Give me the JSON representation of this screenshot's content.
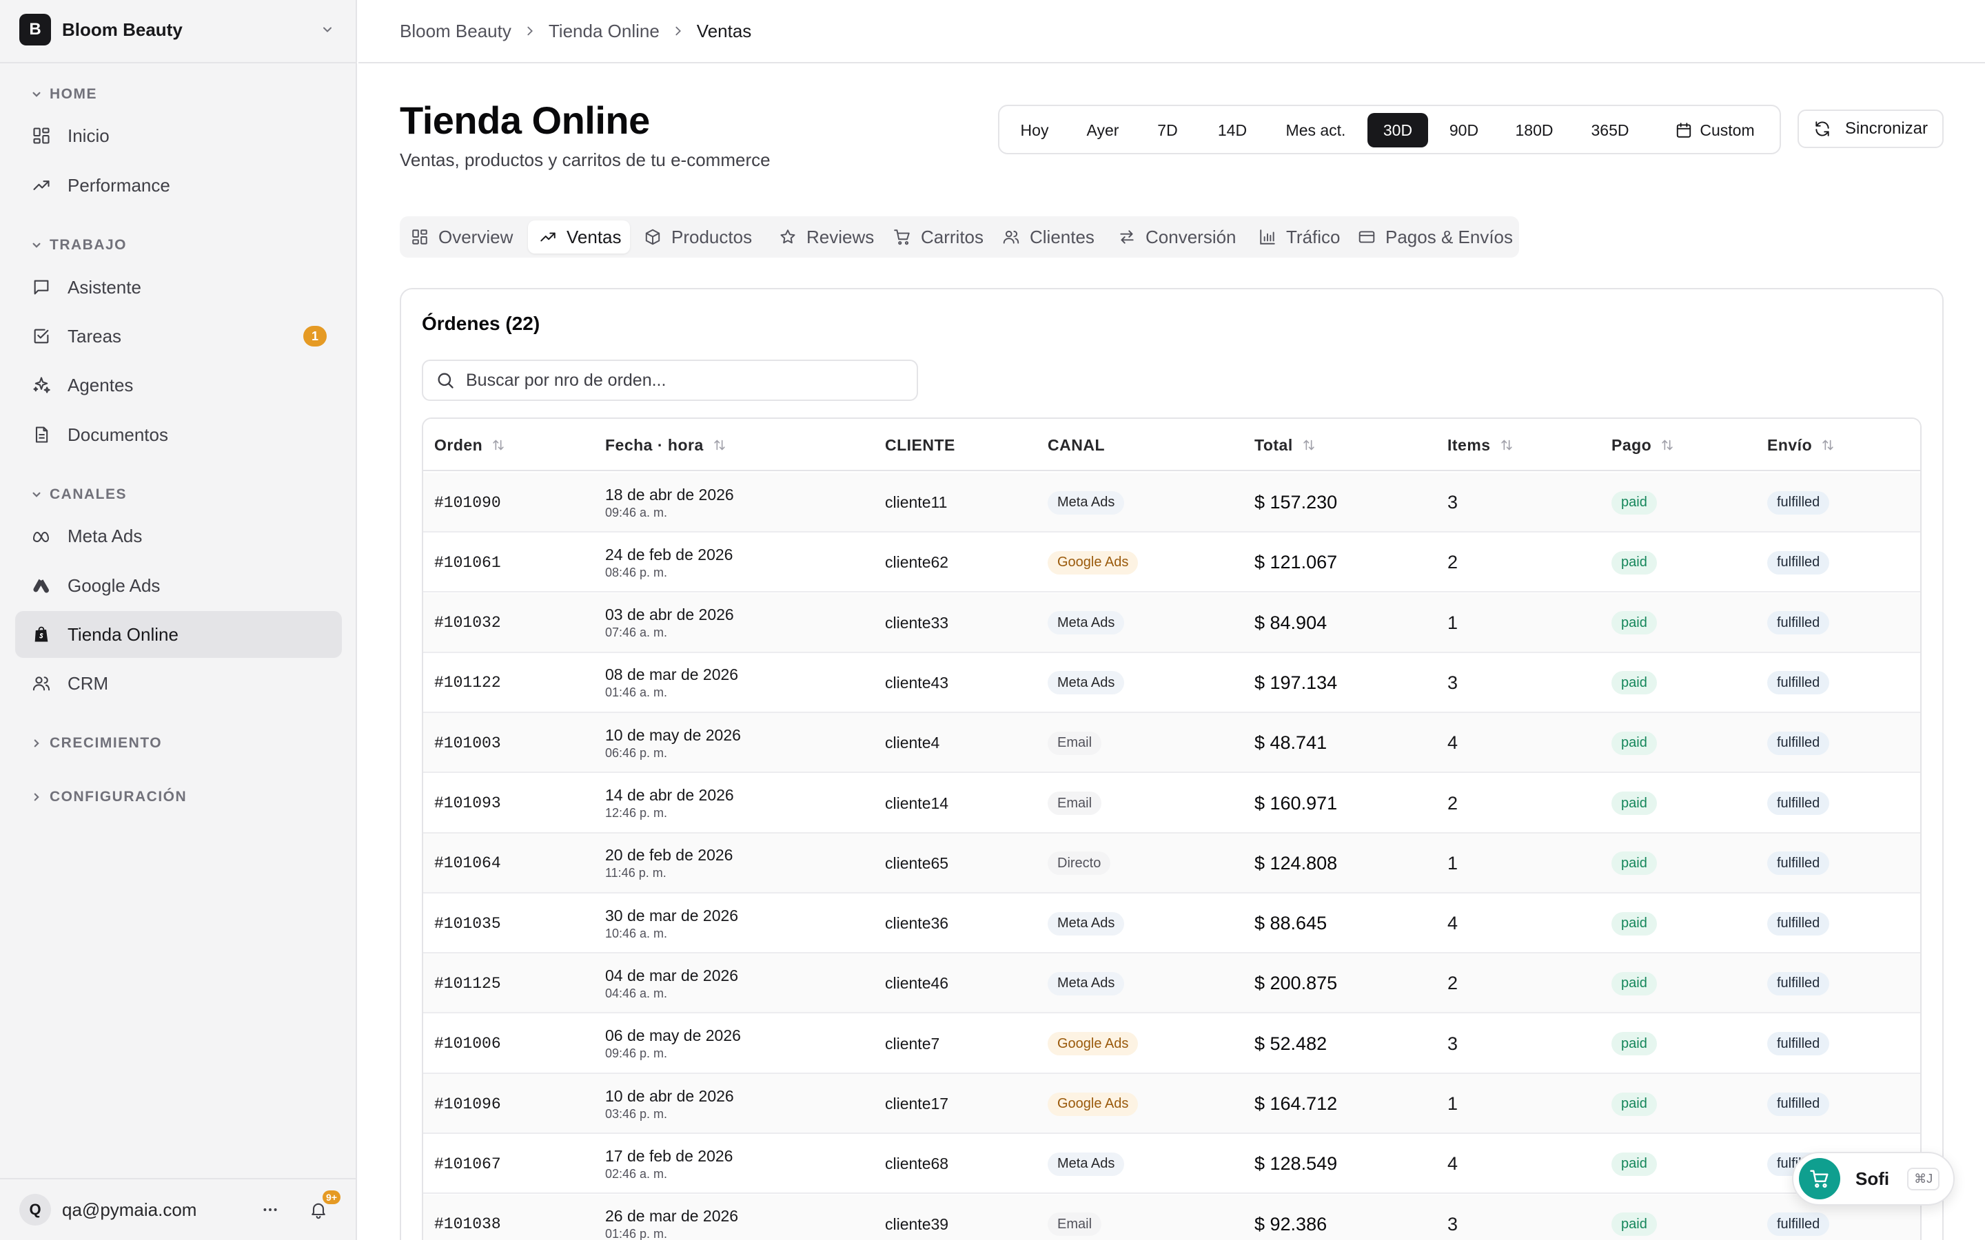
{
  "workspace": {
    "initial": "B",
    "name": "Bloom Beauty"
  },
  "sidebar": {
    "sections": [
      {
        "title": "HOME",
        "items": [
          {
            "label": "Inicio",
            "icon": "grid-icon"
          },
          {
            "label": "Performance",
            "icon": "trending-up-icon"
          }
        ]
      },
      {
        "title": "TRABAJO",
        "items": [
          {
            "label": "Asistente",
            "icon": "chat-icon"
          },
          {
            "label": "Tareas",
            "icon": "checkbox-icon",
            "badge": "1"
          },
          {
            "label": "Agentes",
            "icon": "sparkles-icon"
          },
          {
            "label": "Documentos",
            "icon": "document-icon"
          }
        ]
      },
      {
        "title": "CANALES",
        "items": [
          {
            "label": "Meta Ads",
            "icon": "meta-icon"
          },
          {
            "label": "Google Ads",
            "icon": "google-ads-icon"
          },
          {
            "label": "Tienda Online",
            "icon": "shopify-icon",
            "active": true
          },
          {
            "label": "CRM",
            "icon": "users-icon"
          }
        ]
      },
      {
        "title": "CRECIMIENTO",
        "items": []
      },
      {
        "title": "CONFIGURACIÓN",
        "items": []
      }
    ]
  },
  "user": {
    "initial": "Q",
    "email": "qa@pymaia.com",
    "notifications": "9+"
  },
  "breadcrumb": [
    "Bloom Beauty",
    "Tienda Online",
    "Ventas"
  ],
  "header": {
    "title": "Tienda Online",
    "subtitle": "Ventas, productos y carritos de tu e-commerce"
  },
  "ranges": [
    "Hoy",
    "Ayer",
    "7D",
    "14D",
    "Mes act.",
    "30D",
    "90D",
    "180D",
    "365D",
    "Custom"
  ],
  "active_range": "30D",
  "sync_label": "Sincronizar",
  "tabs": [
    {
      "label": "Overview",
      "icon": "grid-icon"
    },
    {
      "label": "Ventas",
      "icon": "trending-up-icon",
      "active": true
    },
    {
      "label": "Productos",
      "icon": "box-icon"
    },
    {
      "label": "Reviews",
      "icon": "star-icon"
    },
    {
      "label": "Carritos",
      "icon": "cart-icon"
    },
    {
      "label": "Clientes",
      "icon": "users-icon"
    },
    {
      "label": "Conversión",
      "icon": "arrows-icon"
    },
    {
      "label": "Tráfico",
      "icon": "bar-chart-icon"
    },
    {
      "label": "Pagos & Envíos",
      "icon": "credit-card-icon"
    }
  ],
  "orders": {
    "title": "Órdenes (22)",
    "search_placeholder": "Buscar por nro de orden...",
    "columns": [
      "Orden",
      "Fecha · hora",
      "CLIENTE",
      "CANAL",
      "Total",
      "Items",
      "Pago",
      "Envío"
    ],
    "rows": [
      {
        "orden": "#101090",
        "fecha": "18 de abr de 2026",
        "hora": "09:46 a. m.",
        "cliente": "cliente11",
        "canal": "Meta Ads",
        "total": "$ 157.230",
        "items": "3",
        "pago": "paid",
        "envio": "fulfilled"
      },
      {
        "orden": "#101061",
        "fecha": "24 de feb de 2026",
        "hora": "08:46 p. m.",
        "cliente": "cliente62",
        "canal": "Google Ads",
        "total": "$ 121.067",
        "items": "2",
        "pago": "paid",
        "envio": "fulfilled"
      },
      {
        "orden": "#101032",
        "fecha": "03 de abr de 2026",
        "hora": "07:46 a. m.",
        "cliente": "cliente33",
        "canal": "Meta Ads",
        "total": "$ 84.904",
        "items": "1",
        "pago": "paid",
        "envio": "fulfilled"
      },
      {
        "orden": "#101122",
        "fecha": "08 de mar de 2026",
        "hora": "01:46 a. m.",
        "cliente": "cliente43",
        "canal": "Meta Ads",
        "total": "$ 197.134",
        "items": "3",
        "pago": "paid",
        "envio": "fulfilled"
      },
      {
        "orden": "#101003",
        "fecha": "10 de may de 2026",
        "hora": "06:46 p. m.",
        "cliente": "cliente4",
        "canal": "Email",
        "total": "$ 48.741",
        "items": "4",
        "pago": "paid",
        "envio": "fulfilled"
      },
      {
        "orden": "#101093",
        "fecha": "14 de abr de 2026",
        "hora": "12:46 p. m.",
        "cliente": "cliente14",
        "canal": "Email",
        "total": "$ 160.971",
        "items": "2",
        "pago": "paid",
        "envio": "fulfilled"
      },
      {
        "orden": "#101064",
        "fecha": "20 de feb de 2026",
        "hora": "11:46 p. m.",
        "cliente": "cliente65",
        "canal": "Directo",
        "total": "$ 124.808",
        "items": "1",
        "pago": "paid",
        "envio": "fulfilled"
      },
      {
        "orden": "#101035",
        "fecha": "30 de mar de 2026",
        "hora": "10:46 a. m.",
        "cliente": "cliente36",
        "canal": "Meta Ads",
        "total": "$ 88.645",
        "items": "4",
        "pago": "paid",
        "envio": "fulfilled"
      },
      {
        "orden": "#101125",
        "fecha": "04 de mar de 2026",
        "hora": "04:46 a. m.",
        "cliente": "cliente46",
        "canal": "Meta Ads",
        "total": "$ 200.875",
        "items": "2",
        "pago": "paid",
        "envio": "fulfilled"
      },
      {
        "orden": "#101006",
        "fecha": "06 de may de 2026",
        "hora": "09:46 p. m.",
        "cliente": "cliente7",
        "canal": "Google Ads",
        "total": "$ 52.482",
        "items": "3",
        "pago": "paid",
        "envio": "fulfilled"
      },
      {
        "orden": "#101096",
        "fecha": "10 de abr de 2026",
        "hora": "03:46 p. m.",
        "cliente": "cliente17",
        "canal": "Google Ads",
        "total": "$ 164.712",
        "items": "1",
        "pago": "paid",
        "envio": "fulfilled"
      },
      {
        "orden": "#101067",
        "fecha": "17 de feb de 2026",
        "hora": "02:46 a. m.",
        "cliente": "cliente68",
        "canal": "Meta Ads",
        "total": "$ 128.549",
        "items": "4",
        "pago": "paid",
        "envio": "fulfilled"
      },
      {
        "orden": "#101038",
        "fecha": "26 de mar de 2026",
        "hora": "01:46 p. m.",
        "cliente": "cliente39",
        "canal": "Email",
        "total": "$ 92.386",
        "items": "3",
        "pago": "paid",
        "envio": "fulfilled"
      }
    ]
  },
  "assistant": {
    "label": "Sofi",
    "shortcut": "⌘J"
  },
  "colors": {
    "accent": "#18181b",
    "badge": "#e59a24",
    "assistant": "#0f9f8f",
    "paid": "#14865a"
  }
}
